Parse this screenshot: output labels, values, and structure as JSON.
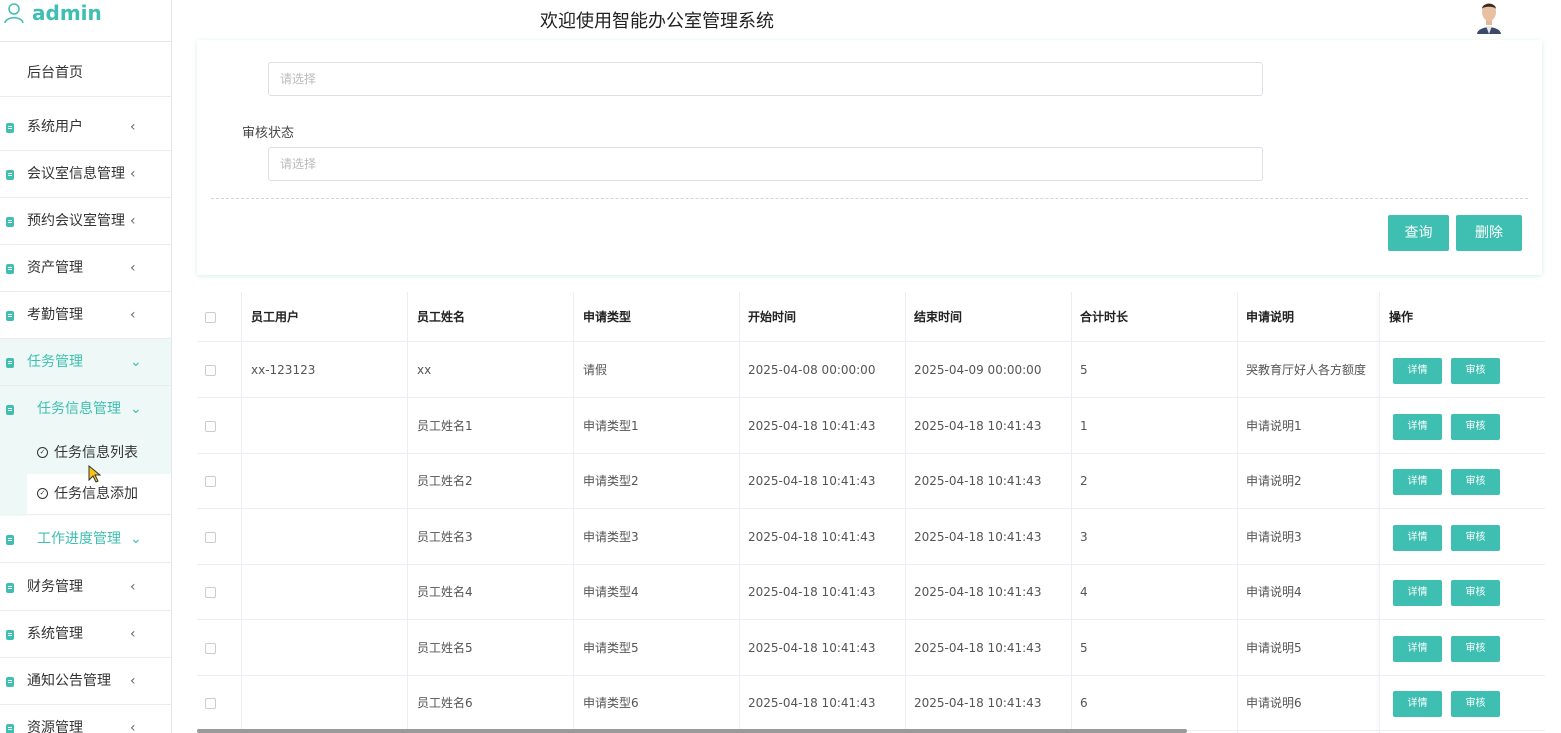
{
  "app": {
    "user": "admin",
    "title": "欢迎使用智能办公室管理系统",
    "accent_color": "#3ebfb1"
  },
  "sidebar": {
    "home": "后台首页",
    "items": [
      {
        "label": "系统用户",
        "arrow": "‹"
      },
      {
        "label": "会议室信息管理",
        "arrow": "‹"
      },
      {
        "label": "预约会议室管理",
        "arrow": "‹"
      },
      {
        "label": "资产管理",
        "arrow": "‹"
      },
      {
        "label": "考勤管理",
        "arrow": "‹"
      },
      {
        "label": "任务管理",
        "arrow": "⌄"
      },
      {
        "label": "任务信息管理",
        "arrow": "⌄"
      },
      {
        "label": "工作进度管理",
        "arrow": "⌄"
      },
      {
        "label": "财务管理",
        "arrow": "‹"
      },
      {
        "label": "系统管理",
        "arrow": "‹"
      },
      {
        "label": "通知公告管理",
        "arrow": "‹"
      },
      {
        "label": "资源管理",
        "arrow": "‹"
      }
    ],
    "sub_items": [
      {
        "label": "任务信息列表",
        "icon": "check-circle-icon"
      },
      {
        "label": "任务信息添加",
        "icon": "check-circle-icon"
      }
    ]
  },
  "search": {
    "placeholder_1": "请选择",
    "status_label": "审核状态",
    "placeholder_2": "请选择",
    "query_button": "查询",
    "delete_button": "删除"
  },
  "table": {
    "headers": [
      "员工用户",
      "员工姓名",
      "申请类型",
      "开始时间",
      "结束时间",
      "合计时长",
      "申请说明",
      "操作"
    ],
    "rows": [
      [
        "xx-123123",
        "xx",
        "请假",
        "2025-04-08 00:00:00",
        "2025-04-09 00:00:00",
        "5",
        "哭教育厅好人各方额度"
      ],
      [
        "",
        "员工姓名1",
        "申请类型1",
        "2025-04-18 10:41:43",
        "2025-04-18 10:41:43",
        "1",
        "申请说明1"
      ],
      [
        "",
        "员工姓名2",
        "申请类型2",
        "2025-04-18 10:41:43",
        "2025-04-18 10:41:43",
        "2",
        "申请说明2"
      ],
      [
        "",
        "员工姓名3",
        "申请类型3",
        "2025-04-18 10:41:43",
        "2025-04-18 10:41:43",
        "3",
        "申请说明3"
      ],
      [
        "",
        "员工姓名4",
        "申请类型4",
        "2025-04-18 10:41:43",
        "2025-04-18 10:41:43",
        "4",
        "申请说明4"
      ],
      [
        "",
        "员工姓名5",
        "申请类型5",
        "2025-04-18 10:41:43",
        "2025-04-18 10:41:43",
        "5",
        "申请说明5"
      ],
      [
        "",
        "员工姓名6",
        "申请类型6",
        "2025-04-18 10:41:43",
        "2025-04-18 10:41:43",
        "6",
        "申请说明6"
      ]
    ],
    "detail_label": "详情",
    "review_label": "审核"
  }
}
